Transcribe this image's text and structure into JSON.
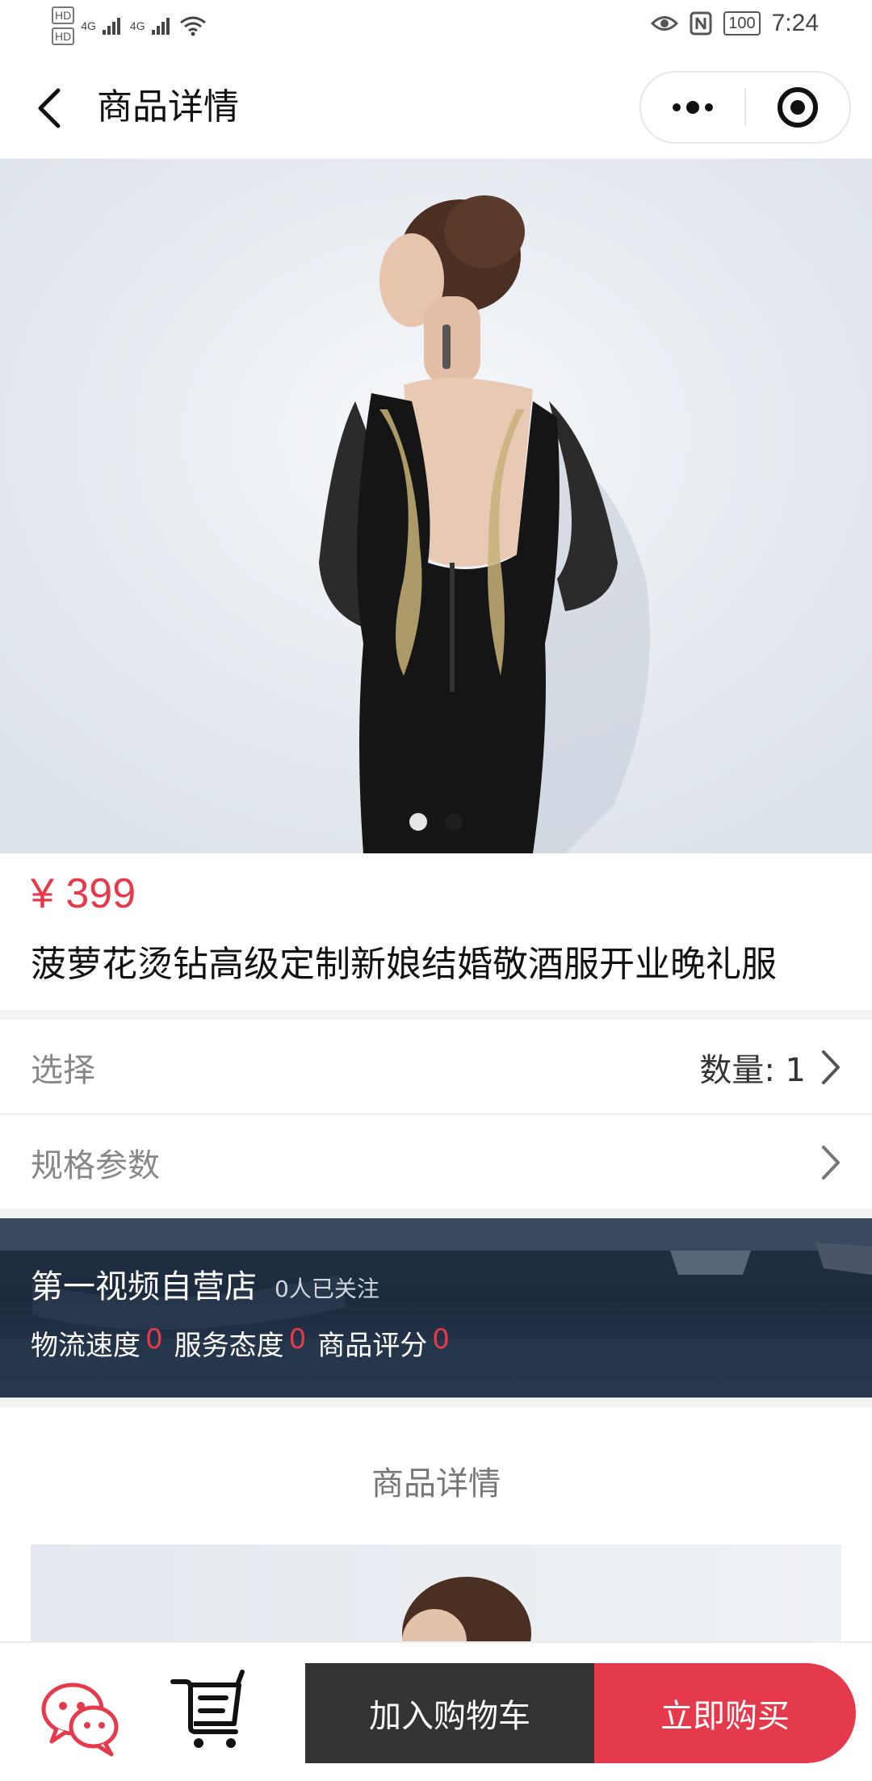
{
  "status_bar": {
    "hd1": "HD",
    "hd2": "HD",
    "signal1": "4G",
    "signal2": "4G",
    "battery": "100",
    "time": "7:24"
  },
  "nav": {
    "title": "商品详情"
  },
  "gallery": {
    "image_count": 2,
    "active_index": 0
  },
  "product": {
    "price": "¥ 399",
    "title": "菠萝花烫钻高级定制新娘结婚敬酒服开业晚礼服"
  },
  "options": {
    "select_label": "选择",
    "quantity_label": "数量: 1",
    "spec_label": "规格参数"
  },
  "store": {
    "name": "第一视频自营店",
    "followers": "0人已关注",
    "metrics": [
      {
        "label": "物流速度",
        "value": "0"
      },
      {
        "label": "服务态度",
        "value": "0"
      },
      {
        "label": "商品评分",
        "value": "0"
      }
    ]
  },
  "detail": {
    "heading": "商品详情"
  },
  "bottom": {
    "add_to_cart": "加入购物车",
    "buy_now": "立即购买"
  },
  "colors": {
    "accent": "#e53a4b",
    "dark_button": "#333333"
  }
}
